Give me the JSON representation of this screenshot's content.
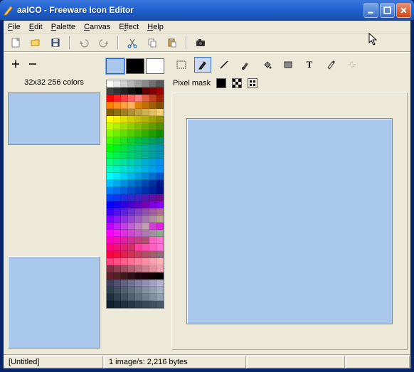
{
  "window": {
    "title": "aaICO - Freeware Icon Editor"
  },
  "menu": {
    "file": "File",
    "edit": "Edit",
    "palette": "Palette",
    "canvas": "Canvas",
    "effect": "Effect",
    "help": "Help"
  },
  "toolbar": {
    "new": "new",
    "open": "open",
    "save": "save",
    "undo": "undo",
    "redo": "redo",
    "cut": "cut",
    "copy": "copy",
    "paste": "paste",
    "camera": "camera"
  },
  "left": {
    "preview_label": "32x32 256 colors"
  },
  "tools": {
    "select": "select",
    "pencil": "pencil",
    "line": "line",
    "brush": "brush",
    "fill": "fill",
    "rect": "rect",
    "text": "text",
    "picker": "picker",
    "wand": "wand"
  },
  "mask": {
    "label": "Pixel mask"
  },
  "colors": {
    "foreground": "#a8c7eb",
    "background": "#000000",
    "transparent": "#ffffff"
  },
  "status": {
    "file": "[Untitled]",
    "info": "1 image/s: 2,216 bytes"
  },
  "palette_rows": [
    [
      "#ffffff",
      "#e8e8e8",
      "#d0d0d0",
      "#b8b8b8",
      "#a0a0a0",
      "#888888",
      "#707070",
      "#585858"
    ],
    [
      "#404040",
      "#303030",
      "#202020",
      "#101010",
      "#000000",
      "#600000",
      "#800000",
      "#a00000"
    ],
    [
      "#ff0000",
      "#ff2020",
      "#ff4040",
      "#ff6060",
      "#ff8080",
      "#e06040",
      "#c04020",
      "#a02000"
    ],
    [
      "#ff8000",
      "#ff9020",
      "#ffa040",
      "#ffb060",
      "#e08000",
      "#c07000",
      "#a06000",
      "#805000"
    ],
    [
      "#806000",
      "#907010",
      "#a08020",
      "#b09030",
      "#c0a040",
      "#d0b050",
      "#e0c060",
      "#f0d070"
    ],
    [
      "#ffff00",
      "#f0f000",
      "#e0e000",
      "#d0d000",
      "#c0c000",
      "#b0b000",
      "#a0a000",
      "#909000"
    ],
    [
      "#c0ff00",
      "#b0f000",
      "#a0e000",
      "#90d000",
      "#80c000",
      "#70b000",
      "#60a000",
      "#509000"
    ],
    [
      "#80ff00",
      "#70f000",
      "#60e000",
      "#50d000",
      "#40c000",
      "#30b000",
      "#20a000",
      "#109000"
    ],
    [
      "#40ff00",
      "#30f010",
      "#20e020",
      "#10d030",
      "#00c040",
      "#00b050",
      "#00a060",
      "#009070"
    ],
    [
      "#00ff00",
      "#00f020",
      "#00e040",
      "#00d060",
      "#00c080",
      "#00b090",
      "#00a0a0",
      "#0090b0"
    ],
    [
      "#00ff40",
      "#00f050",
      "#00e060",
      "#00d070",
      "#00c080",
      "#00b090",
      "#00a0a0",
      "#0090b0"
    ],
    [
      "#00ff80",
      "#00f090",
      "#00e0a0",
      "#00d0b0",
      "#00c0c0",
      "#00b0d0",
      "#00a0e0",
      "#0090f0"
    ],
    [
      "#00ffc0",
      "#00f0c8",
      "#00e0d0",
      "#00d0d8",
      "#00c0e0",
      "#00b0e8",
      "#00a0f0",
      "#0090f8"
    ],
    [
      "#00ffff",
      "#00e8f8",
      "#00d0f0",
      "#00b8e8",
      "#00a0e0",
      "#0088d8",
      "#0070d0",
      "#0058c8"
    ],
    [
      "#00c0ff",
      "#00a8f0",
      "#0090e0",
      "#0078d0",
      "#0060c0",
      "#0048b0",
      "#0030a0",
      "#001890"
    ],
    [
      "#0080ff",
      "#0070f0",
      "#0060e0",
      "#0050d0",
      "#0040c0",
      "#0030b0",
      "#0020a0",
      "#001090"
    ],
    [
      "#0040ff",
      "#1038f0",
      "#2030e0",
      "#3028d0",
      "#4020c0",
      "#5018b0",
      "#6010a0",
      "#700890"
    ],
    [
      "#0000ff",
      "#1800f0",
      "#3000e0",
      "#4800d0",
      "#6000c0",
      "#7800b0",
      "#8000e0",
      "#8800f0"
    ],
    [
      "#4000ff",
      "#5010f0",
      "#6020e0",
      "#7030d0",
      "#8040c0",
      "#9050b0",
      "#a060a0",
      "#b07090"
    ],
    [
      "#8000ff",
      "#8818f0",
      "#9030e0",
      "#9848d0",
      "#a060c0",
      "#a878b0",
      "#b090a0",
      "#b8a890"
    ],
    [
      "#c000ff",
      "#c020f0",
      "#c040e0",
      "#c060d0",
      "#c080c0",
      "#c0a0b0",
      "#d040d0",
      "#e020e0"
    ],
    [
      "#ff00ff",
      "#f018f0",
      "#e030e0",
      "#d048d0",
      "#c060c0",
      "#b078b0",
      "#a090a0",
      "#90a890"
    ],
    [
      "#ff00c0",
      "#f010b0",
      "#e020a0",
      "#d03090",
      "#c04080",
      "#b05070",
      "#ff60c0",
      "#ff70d0"
    ],
    [
      "#ff0080",
      "#f01078",
      "#e02070",
      "#d03068",
      "#ff40a0",
      "#ff50b0",
      "#ff60c0",
      "#ff70d0"
    ],
    [
      "#ff0040",
      "#f01048",
      "#e02050",
      "#d03058",
      "#c04060",
      "#b05068",
      "#a06070",
      "#907078"
    ],
    [
      "#ff4080",
      "#ff5088",
      "#ff6090",
      "#ff7098",
      "#ff80a0",
      "#ff90a8",
      "#ffa0b0",
      "#ffb0b8"
    ],
    [
      "#803040",
      "#904050",
      "#a05060",
      "#b06070",
      "#c07080",
      "#d08090",
      "#e090a0",
      "#f0a0b0"
    ],
    [
      "#602030",
      "#502028",
      "#401820",
      "#301018",
      "#200810",
      "#180408",
      "#100204",
      "#080000"
    ],
    [
      "#404060",
      "#505070",
      "#606080",
      "#707090",
      "#8080a0",
      "#9090b0",
      "#a0a0c0",
      "#b0b0d0"
    ],
    [
      "#304050",
      "#405060",
      "#506070",
      "#607080",
      "#708090",
      "#8090a0",
      "#90a0b0",
      "#a0b0c0"
    ],
    [
      "#203040",
      "#304050",
      "#405060",
      "#506070",
      "#607080",
      "#708090",
      "#8090a0",
      "#90a0b0"
    ],
    [
      "#102030",
      "#182838",
      "#203040",
      "#283848",
      "#304050",
      "#384858",
      "#405060",
      "#485868"
    ]
  ]
}
